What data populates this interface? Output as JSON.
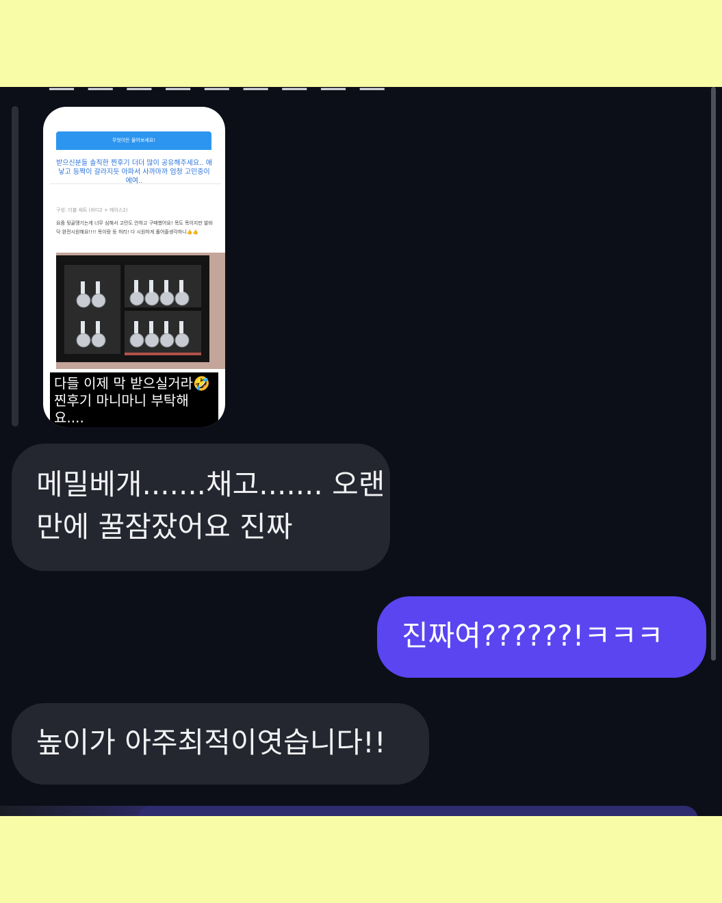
{
  "partial_top_text": "— — — — — — — — —",
  "story": {
    "banner": "무엇이든 물어보세요!",
    "notice": "받으신분들 솔직한 찐후기 더더 많이 공유해주세요.. 애낳고 등짝이 갈라지듯 아파서 사까마까 엄청 고민중이에여..",
    "option": "구성: 더블 세트 (바디2 + 헤이스2)",
    "review": "요즘 뒷골땡기는게 너무 심해서 고민도 안하고 구매했어요! 목도 목이지만 발바닥 완전시원해요!!!! 목이랑 등 허리! 다 시원하게 풀어줄생각하니👍👍",
    "caption": "다들 이제 막 받으실거라🤣 찐후기 마니마니 부탁해요...."
  },
  "messages": [
    {
      "side": "left",
      "text": "메밀베개.......채고....... 오랜만에 꿀잠잤어요 진짜"
    },
    {
      "side": "right",
      "text": "진짜여??????!ㅋㅋㅋ"
    },
    {
      "side": "left",
      "text": "높이가 아주최적이엿습니다!!"
    }
  ],
  "colors": {
    "background_band": "#f9fca7",
    "chat_background": "#0c0f18",
    "incoming_bubble": "#24272f",
    "outgoing_bubble": "#5a45f0",
    "story_banner": "#2c95f0"
  }
}
